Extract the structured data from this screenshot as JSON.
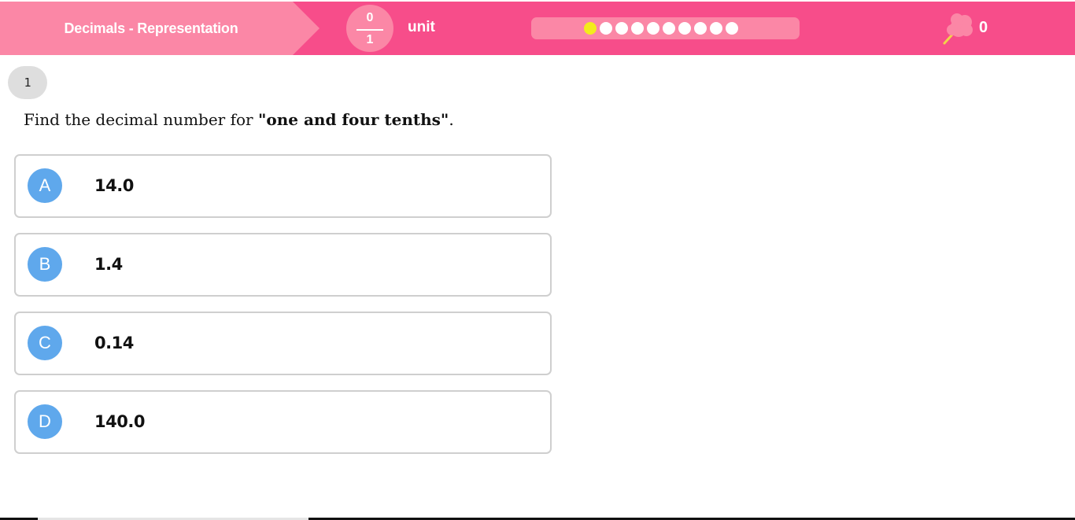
{
  "header": {
    "topic_title": "Decimals - Representation",
    "fraction": {
      "numerator": "0",
      "denominator": "1"
    },
    "unit_label": "unit",
    "progress": {
      "total_steps": 10,
      "current_step": 1
    },
    "score": "0",
    "icon": "cotton-candy-icon",
    "colors": {
      "bar": "#f74d8a",
      "accent_light": "#fb87a6",
      "current_dot": "#f3ec1c"
    }
  },
  "question": {
    "number": "1",
    "text_before": "Find the decimal number for ",
    "text_emphasis": "\"one and four tenths\"",
    "text_after": "."
  },
  "options": [
    {
      "letter": "A",
      "value": "14.0"
    },
    {
      "letter": "B",
      "value": "1.4"
    },
    {
      "letter": "C",
      "value": "0.14"
    },
    {
      "letter": "D",
      "value": "140.0"
    }
  ],
  "colors": {
    "option_letter_bg": "#5fa8ec",
    "option_border": "#cfcfcf"
  }
}
